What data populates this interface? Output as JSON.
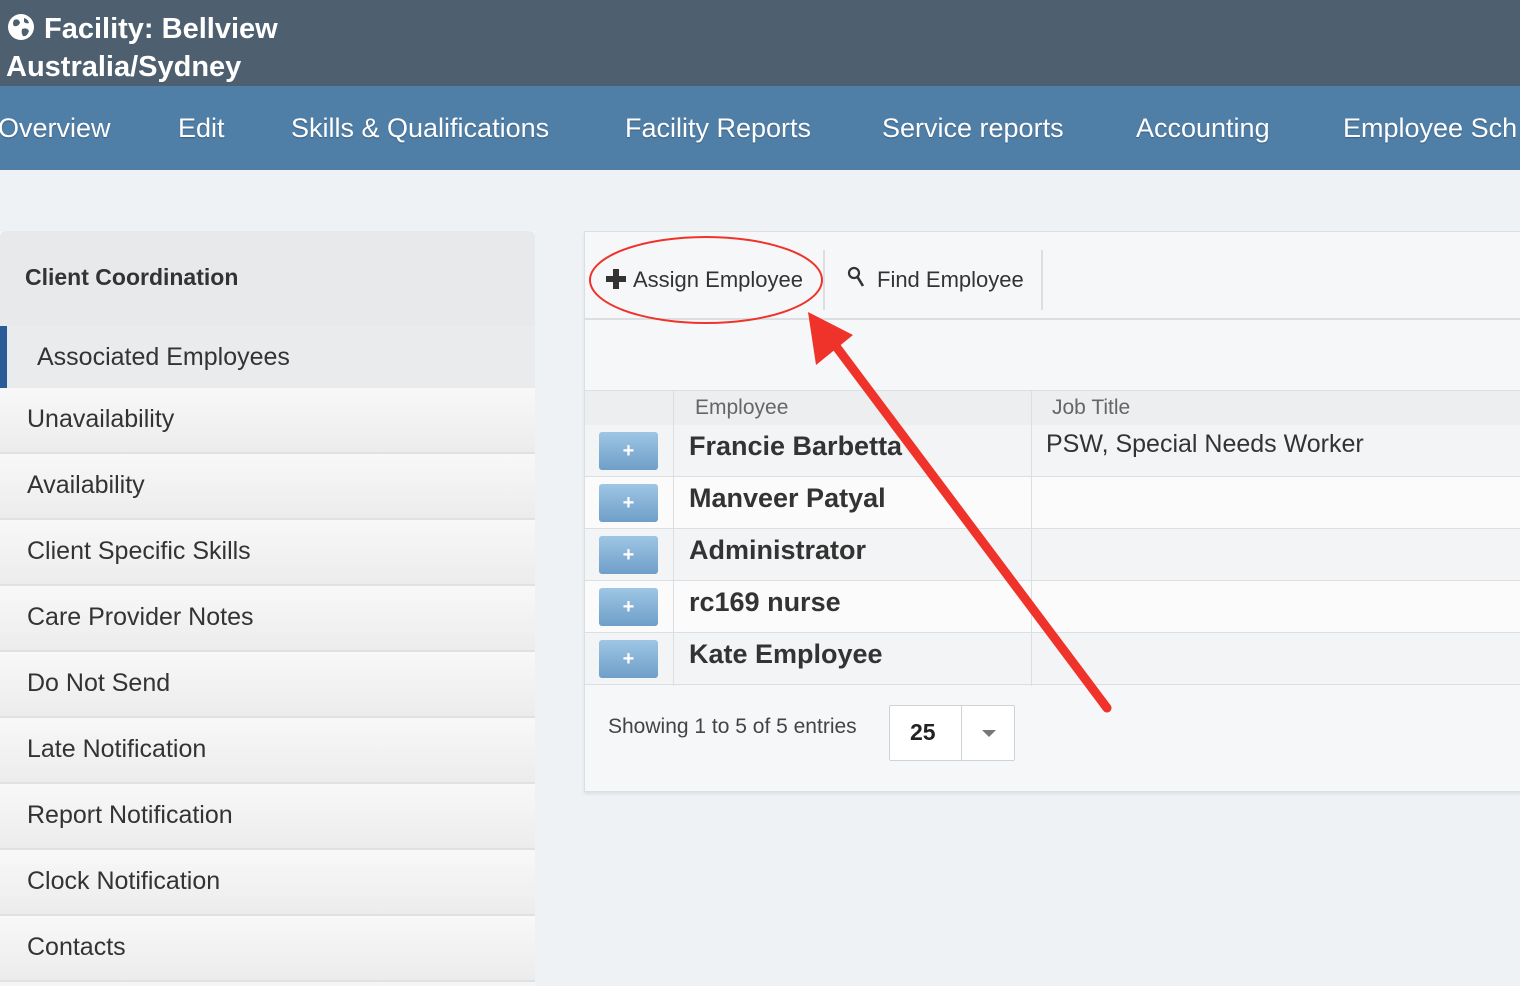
{
  "header": {
    "title_line1": "Facility: Bellview",
    "title_line2": "Australia/Sydney"
  },
  "nav": {
    "items": [
      "Overview",
      "Edit",
      "Skills & Qualifications",
      "Facility Reports",
      "Service reports",
      "Accounting",
      "Employee Sch"
    ]
  },
  "sidebar": {
    "header": "Client Coordination",
    "items": [
      "Associated Employees",
      "Unavailability",
      "Availability",
      "Client Specific Skills",
      "Care Provider Notes",
      "Do Not Send",
      "Late Notification",
      "Report Notification",
      "Clock Notification",
      "Contacts"
    ],
    "active_index": 0
  },
  "toolbar": {
    "assign_label": "Assign Employee",
    "find_label": "Find Employee"
  },
  "table": {
    "columns": [
      "Employee",
      "Job Title"
    ],
    "rows": [
      {
        "employee": "Francie Barbetta",
        "job_title": "PSW, Special Needs Worker"
      },
      {
        "employee": "Manveer Patyal",
        "job_title": ""
      },
      {
        "employee": "Administrator",
        "job_title": ""
      },
      {
        "employee": "rc169 nurse",
        "job_title": ""
      },
      {
        "employee": "Kate Employee",
        "job_title": ""
      }
    ],
    "expand_label": "+"
  },
  "footer": {
    "showing_text": "Showing 1 to 5 of 5 entries",
    "page_size": "25"
  },
  "annotation": {
    "color": "#f0332a"
  }
}
